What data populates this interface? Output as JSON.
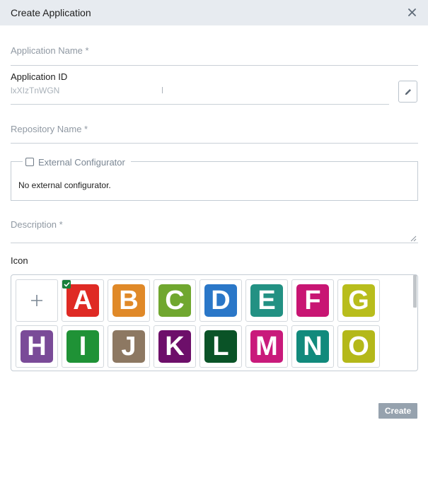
{
  "dialog": {
    "title": "Create Application"
  },
  "form": {
    "application_name": {
      "placeholder": "Application Name *",
      "value": ""
    },
    "application_id": {
      "label": "Application ID",
      "value": "lxXIzTnWGN"
    },
    "repository_name": {
      "placeholder": "Repository Name *",
      "value": ""
    },
    "external_configurator": {
      "label": "External Configurator",
      "checked": false,
      "message": "No external configurator."
    },
    "description": {
      "placeholder": "Description *",
      "value": ""
    }
  },
  "icon_picker": {
    "label": "Icon",
    "selected": "A",
    "icons": [
      {
        "letter": "A",
        "color": "#df2a24"
      },
      {
        "letter": "B",
        "color": "#e08928"
      },
      {
        "letter": "C",
        "color": "#70a72f"
      },
      {
        "letter": "D",
        "color": "#2a77c8"
      },
      {
        "letter": "E",
        "color": "#229183"
      },
      {
        "letter": "F",
        "color": "#c81573"
      },
      {
        "letter": "G",
        "color": "#b8bd1c"
      },
      {
        "letter": "H",
        "color": "#7a4b98"
      },
      {
        "letter": "I",
        "color": "#1f9236"
      },
      {
        "letter": "J",
        "color": "#8d7862"
      },
      {
        "letter": "K",
        "color": "#6d0f6a"
      },
      {
        "letter": "L",
        "color": "#0a5327"
      },
      {
        "letter": "M",
        "color": "#c91a7b"
      },
      {
        "letter": "N",
        "color": "#128a7c"
      },
      {
        "letter": "O",
        "color": "#b4b819"
      }
    ]
  },
  "actions": {
    "create_label": "Create"
  },
  "colors": {
    "header_bg": "#e7ebf0",
    "primary_button": "#96a2ae",
    "selected_check": "#187f3a"
  }
}
